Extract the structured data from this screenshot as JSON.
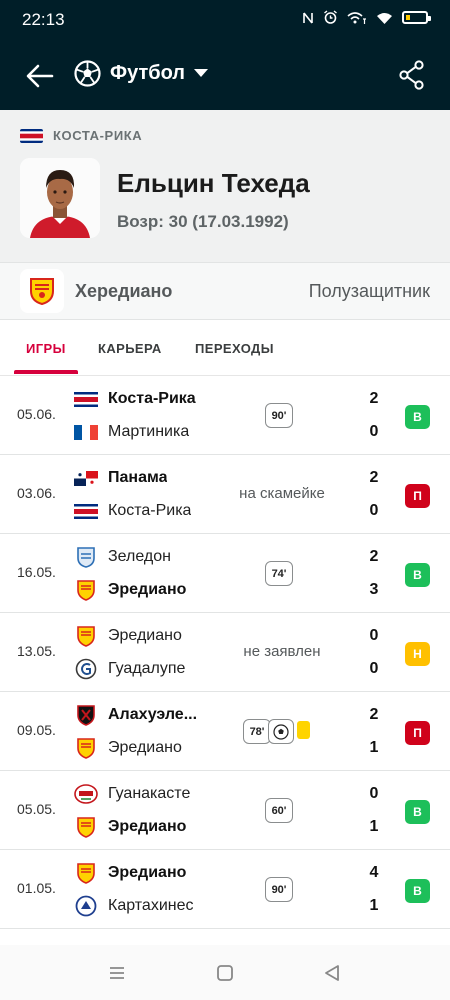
{
  "status_bar": {
    "time": "22:13",
    "icons": [
      "nfc-icon",
      "alarm-icon",
      "wifi-call-icon",
      "wifi-icon",
      "battery-icon"
    ],
    "battery_level": 0.2
  },
  "app_bar": {
    "sport": "Футбол",
    "back_icon": "arrow-left-icon",
    "sport_icon": "soccer-ball-icon",
    "dropdown_icon": "caret-down-icon",
    "share_icon": "share-icon",
    "background": "#001e28"
  },
  "player": {
    "country": "КОСТА-РИКА",
    "name": "Ельцин Техеда",
    "age": "Возр: 30 (17.03.1992)",
    "team": "Хередиано",
    "position": "Полузащитник"
  },
  "tabs": [
    {
      "label": "ИГРЫ",
      "active": true
    },
    {
      "label": "КАРЬЕРА",
      "active": false
    },
    {
      "label": "ПЕРЕХОДЫ",
      "active": false
    }
  ],
  "colors": {
    "accent": "#d6003c",
    "win": "#1dbf5a",
    "loss": "#d0021b",
    "draw": "#ffc000",
    "yellow_card": "#ffd400"
  },
  "matches": [
    {
      "date": "05.06.",
      "team1": "Коста-Рика",
      "team1_bold": true,
      "team2": "Мартиника",
      "team2_bold": false,
      "score1": "2",
      "score2": "0",
      "minutes": "90'",
      "note": "",
      "result": "В",
      "result_type": "win"
    },
    {
      "date": "03.06.",
      "team1": "Панама",
      "team1_bold": true,
      "team2": "Коста-Рика",
      "team2_bold": false,
      "score1": "2",
      "score2": "0",
      "minutes": "",
      "note": "на скамейке",
      "result": "П",
      "result_type": "loss"
    },
    {
      "date": "16.05.",
      "team1": "Зеледон",
      "team1_bold": false,
      "team2": "Эредиано",
      "team2_bold": true,
      "score1": "2",
      "score2": "3",
      "minutes": "74'",
      "note": "",
      "result": "В",
      "result_type": "win"
    },
    {
      "date": "13.05.",
      "team1": "Эредиано",
      "team1_bold": false,
      "team2": "Гуадалупе",
      "team2_bold": false,
      "score1": "0",
      "score2": "0",
      "minutes": "",
      "note": "не заявлен",
      "result": "Н",
      "result_type": "draw"
    },
    {
      "date": "09.05.",
      "team1": "Алахуэле...",
      "team1_bold": true,
      "team2": "Эредиано",
      "team2_bold": false,
      "score1": "2",
      "score2": "1",
      "minutes": "78'",
      "note": "",
      "result": "П",
      "result_type": "loss",
      "events": [
        "goal-icon",
        "yellow-card-icon"
      ]
    },
    {
      "date": "05.05.",
      "team1": "Гуанакасте",
      "team1_bold": false,
      "team2": "Эредиано",
      "team2_bold": true,
      "score1": "0",
      "score2": "1",
      "minutes": "60'",
      "note": "",
      "result": "В",
      "result_type": "win"
    },
    {
      "date": "01.05.",
      "team1": "Эредиано",
      "team1_bold": true,
      "team2": "Картахинес",
      "team2_bold": false,
      "score1": "4",
      "score2": "1",
      "minutes": "90'",
      "note": "",
      "result": "В",
      "result_type": "win"
    }
  ],
  "nav": [
    "menu-icon",
    "home-square-icon",
    "back-triangle-icon"
  ]
}
